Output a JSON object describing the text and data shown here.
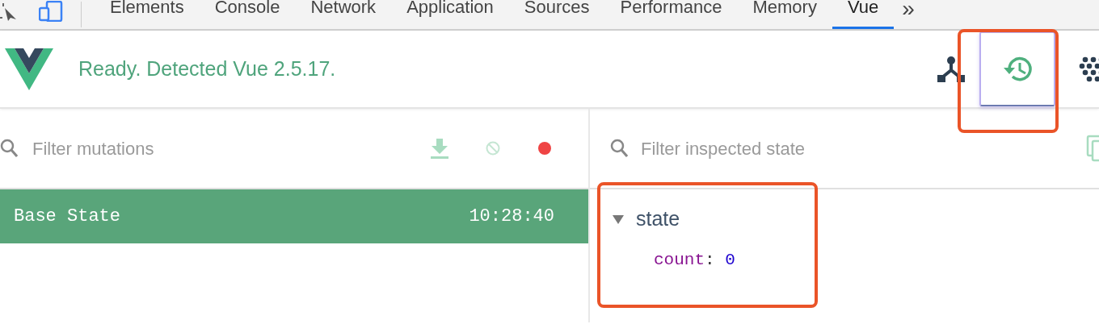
{
  "devtools_tabs": [
    {
      "label": "Elements",
      "selected": false
    },
    {
      "label": "Console",
      "selected": false
    },
    {
      "label": "Network",
      "selected": false
    },
    {
      "label": "Application",
      "selected": false
    },
    {
      "label": "Sources",
      "selected": false
    },
    {
      "label": "Performance",
      "selected": false
    },
    {
      "label": "Memory",
      "selected": false
    },
    {
      "label": "Vue",
      "selected": true
    }
  ],
  "more_tabs": "»",
  "vue_header": {
    "status": "Ready. Detected Vue 2.5.17.",
    "views": [
      {
        "kind": "components",
        "selected": false
      },
      {
        "kind": "vuex",
        "selected": true
      },
      {
        "kind": "events",
        "selected": false
      }
    ]
  },
  "mutations_panel": {
    "search": {
      "placeholder": "Filter mutations"
    },
    "recording": true,
    "items": [
      {
        "name": "Base State",
        "time": "10:28:40",
        "selected": true
      }
    ]
  },
  "state_panel": {
    "search": {
      "placeholder": "Filter inspected state"
    },
    "tree": [
      {
        "key": "state",
        "expanded": true,
        "children": [
          {
            "key": "count",
            "separator": ":",
            "value": "0"
          }
        ]
      }
    ]
  }
}
